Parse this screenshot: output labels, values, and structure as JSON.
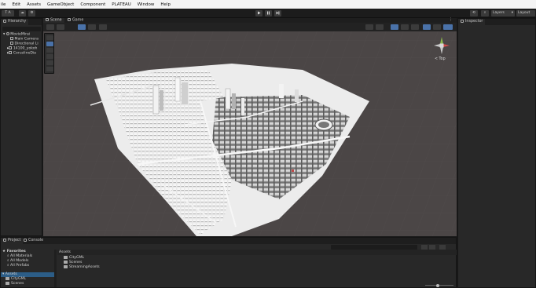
{
  "menu": [
    "ile",
    "Edit",
    "Assets",
    "GameObject",
    "Component",
    "PLATEAU",
    "Window",
    "Help"
  ],
  "toolbar": {
    "account_label": "T A",
    "layers_label": "Layers",
    "layout_label": "Layout"
  },
  "hierarchy": {
    "tab_label": "Hierarchy",
    "items": [
      {
        "label": "MovieMirai"
      },
      {
        "label": "Main Camera"
      },
      {
        "label": "Directional Li"
      },
      {
        "label": "14100_yokoh"
      },
      {
        "label": "CoruslineDia"
      }
    ]
  },
  "scene": {
    "tabs": [
      "Scene",
      "Game"
    ],
    "gizmo_label": "< Top"
  },
  "inspector": {
    "tab_label": "Inspector"
  },
  "project": {
    "tabs": [
      "Project",
      "Console"
    ],
    "favorites_label": "Favorites",
    "favorites": [
      "All Materials",
      "All Models",
      "All Prefabs"
    ],
    "assets_label": "Assets",
    "assets_tree": [
      "CityGML",
      "Scenes"
    ],
    "main_header": "Assets",
    "main_items": [
      "CityGML",
      "Scenes",
      "StreamingAssets"
    ]
  },
  "colors": {
    "accent": "#4a72a9",
    "scene_background": "#4b4646",
    "panel": "#282828"
  }
}
